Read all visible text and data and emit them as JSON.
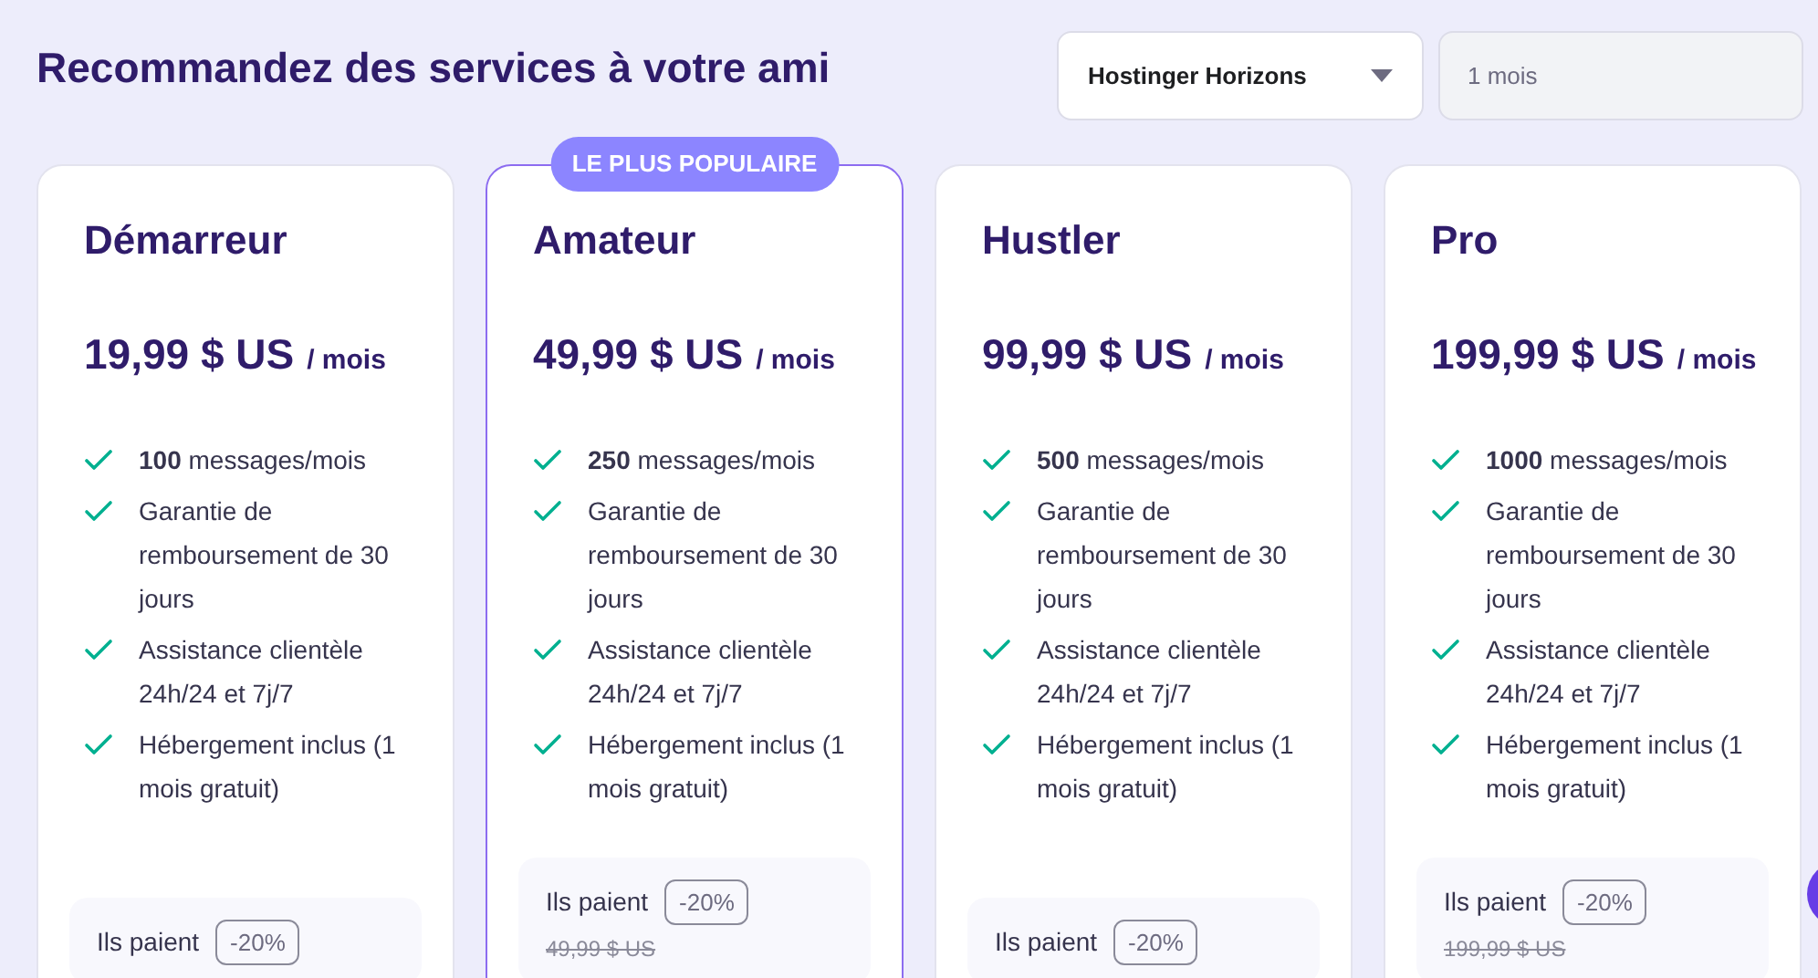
{
  "title": "Recommandez des services à votre ami",
  "product_select": {
    "value": "Hostinger Horizons"
  },
  "period_field": {
    "value": "1 mois",
    "disabled": true
  },
  "plans": [
    {
      "name": "Démarreur",
      "featured": false,
      "price": "19,99 $ US",
      "period": "/ mois",
      "features": [
        "**100** messages/mois",
        "Garantie de remboursement de 30 jours",
        "Assistance clientèle 24h/24 et 7j/7",
        "Hébergement inclus (1 mois gratuit)"
      ],
      "pay_label": "Ils paient",
      "discount": "-20%"
    },
    {
      "name": "Amateur",
      "featured": true,
      "badge": "LE PLUS POPULAIRE",
      "price": "49,99 $ US",
      "period": "/ mois",
      "features": [
        "**250** messages/mois",
        "Garantie de remboursement de 30 jours",
        "Assistance clientèle 24h/24 et 7j/7",
        "Hébergement inclus (1 mois gratuit)"
      ],
      "pay_label": "Ils paient",
      "discount": "-20%",
      "old_price": "49,99 $ US"
    },
    {
      "name": "Hustler",
      "featured": false,
      "price": "99,99 $ US",
      "period": "/ mois",
      "features": [
        "**500** messages/mois",
        "Garantie de remboursement de 30 jours",
        "Assistance clientèle 24h/24 et 7j/7",
        "Hébergement inclus (1 mois gratuit)"
      ],
      "pay_label": "Ils paient",
      "discount": "-20%"
    },
    {
      "name": "Pro",
      "featured": false,
      "price": "199,99 $ US",
      "period": "/ mois",
      "features": [
        "**1000** messages/mois",
        "Garantie de remboursement de 30 jours",
        "Assistance clientèle 24h/24 et 7j/7",
        "Hébergement inclus (1 mois gratuit)"
      ],
      "pay_label": "Ils paient",
      "discount": "-20%",
      "old_price": "199,99 $ US"
    }
  ]
}
